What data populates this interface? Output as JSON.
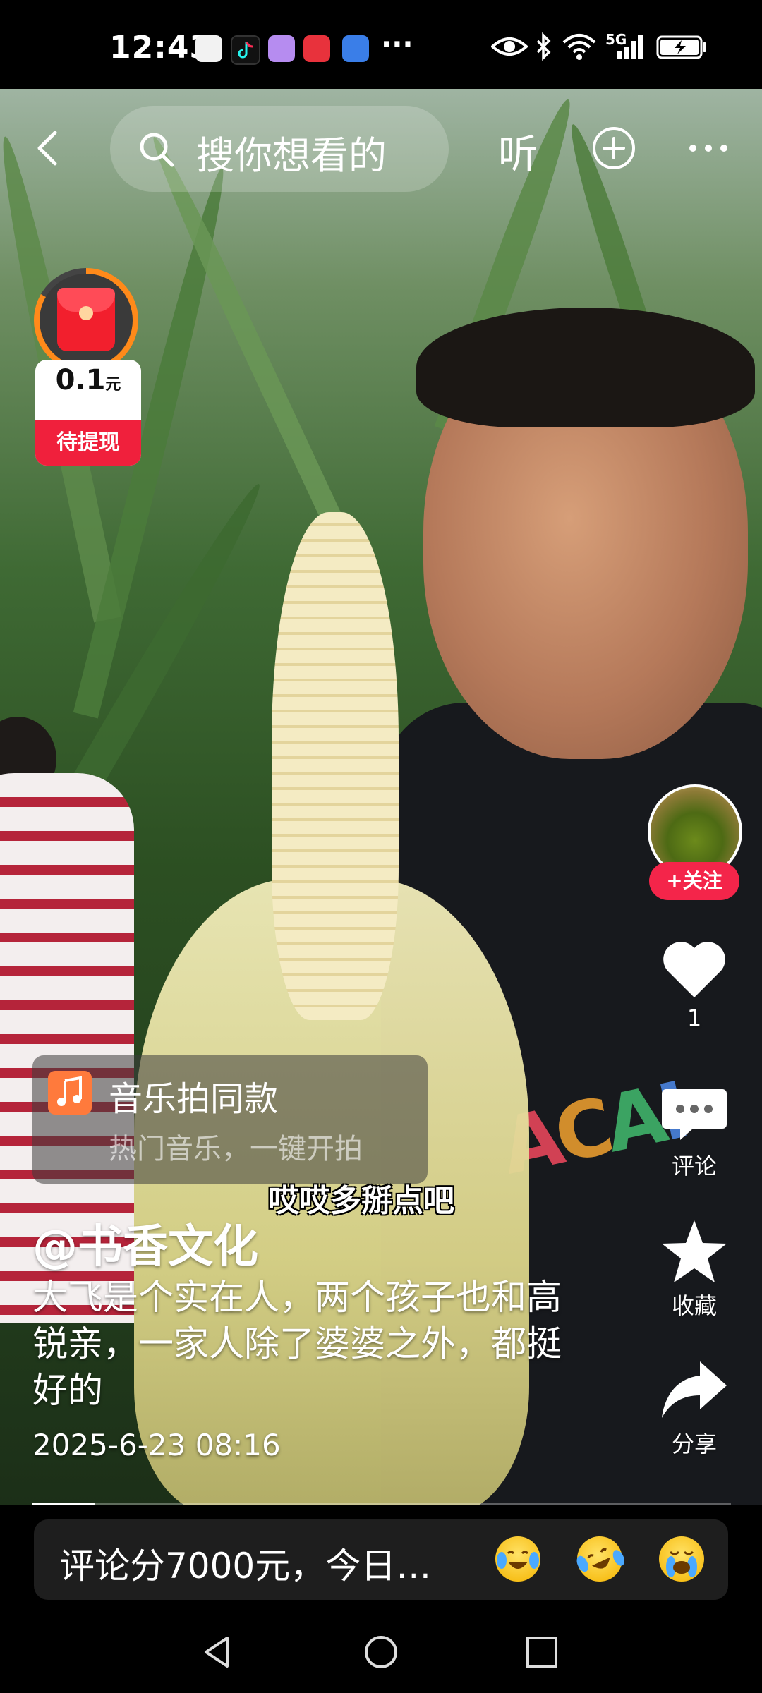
{
  "status_bar": {
    "time": "12:43",
    "more": "···",
    "network": "5G",
    "icons": [
      "huawei-app-icon",
      "tiktok-icon",
      "app-icon",
      "red-app-icon",
      "game-app-icon",
      "eye-icon",
      "bluetooth-icon",
      "wifi-icon",
      "signal-icon",
      "battery-icon"
    ]
  },
  "top_bar": {
    "search_placeholder": "搜你想看的",
    "listen_label": "听"
  },
  "red_packet": {
    "amount": "0.1",
    "unit": "元",
    "label": "待提现"
  },
  "side_actions": {
    "follow_label": "+关注",
    "like_count": "1",
    "comment_label": "评论",
    "favorite_label": "收藏",
    "share_label": "分享"
  },
  "music": {
    "title": "音乐拍同款",
    "subtitle": "热门音乐，一键开拍"
  },
  "video": {
    "subtitle": "哎哎多掰点吧",
    "author": "@书香文化",
    "caption": "大飞是个实在人，两个孩子也和高锐亲，一家人除了婆婆之外，都挺好的",
    "date": "2025-6-23 08:16",
    "progress": 0.09
  },
  "comment_bar": {
    "text": "评论分7000元，今日…",
    "emojis": [
      "crying-laugh-emoji",
      "rolling-laugh-emoji",
      "crying-emoji"
    ]
  },
  "colors": {
    "accent_red": "#f4254a",
    "red_packet_ring": "#ff8a1a",
    "music_icon": "#ff7a3c"
  }
}
